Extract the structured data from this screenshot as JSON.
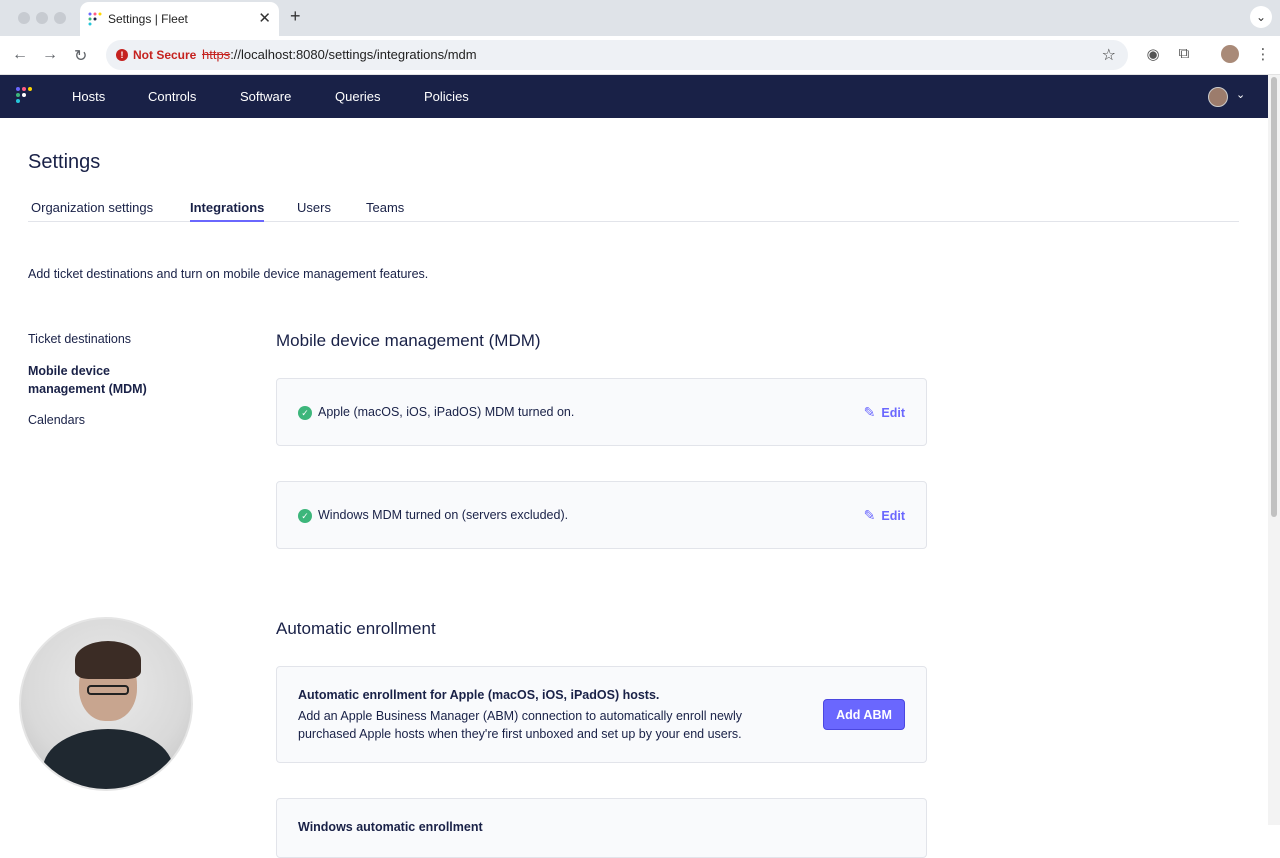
{
  "browser": {
    "tab_title": "Settings | Fleet",
    "tab_close": "✕",
    "new_tab": "+",
    "not_secure": "Not Secure",
    "url_proto": "https",
    "url_rest": "://localhost:8080/settings/integrations/mdm"
  },
  "appnav": {
    "items": [
      "Hosts",
      "Controls",
      "Software",
      "Queries",
      "Policies"
    ]
  },
  "page": {
    "title": "Settings",
    "tabs": [
      "Organization settings",
      "Integrations",
      "Users",
      "Teams"
    ],
    "intro": "Add ticket destinations and turn on mobile device management features."
  },
  "sidenav": {
    "items": [
      "Ticket destinations",
      "Mobile device management (MDM)",
      "Calendars"
    ]
  },
  "mdm": {
    "title": "Mobile device management (MDM)",
    "apple_status": "Apple (macOS, iOS, iPadOS) MDM turned on.",
    "windows_status": "Windows MDM turned on (servers excluded).",
    "edit_label": "Edit"
  },
  "enrollment": {
    "title": "Automatic enrollment",
    "apple_heading": "Automatic enrollment for Apple (macOS, iOS, iPadOS) hosts.",
    "apple_body": "Add an Apple Business Manager (ABM) connection to automatically enroll newly purchased Apple hosts when they're first unboxed and set up by your end users.",
    "add_abm_label": "Add ABM",
    "windows_heading": "Windows automatic enrollment"
  },
  "colors": {
    "nav_bg": "#192147",
    "accent": "#6a67fe",
    "success": "#3db67b"
  }
}
